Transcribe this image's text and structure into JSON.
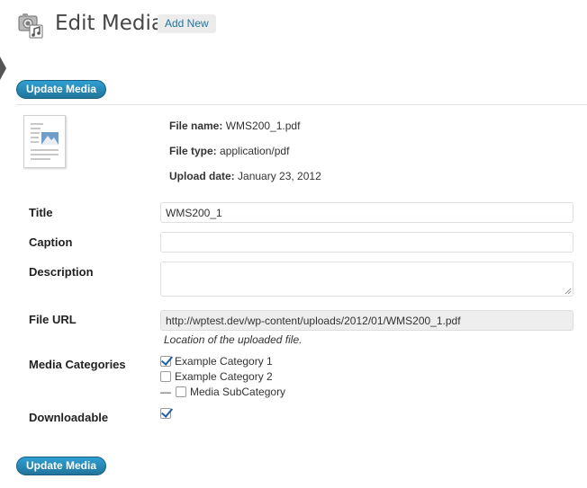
{
  "header": {
    "icon": "media-library-icon",
    "title": "Edit Media",
    "add_new_label": "Add New"
  },
  "actions": {
    "update_label": "Update Media"
  },
  "file_info": {
    "name_label": "File name:",
    "name_value": "WMS200_1.pdf",
    "type_label": "File type:",
    "type_value": "application/pdf",
    "date_label": "Upload date:",
    "date_value": "January 23, 2012"
  },
  "fields": {
    "title_label": "Title",
    "title_value": "WMS200_1",
    "caption_label": "Caption",
    "caption_value": "",
    "description_label": "Description",
    "description_value": "",
    "url_label": "File URL",
    "url_value": "http://wptest.dev/wp-content/uploads/2012/01/WMS200_1.pdf",
    "url_note": "Location of the uploaded file."
  },
  "categories": {
    "label": "Media Categories",
    "items": [
      {
        "label": "Example Category 1",
        "checked": true
      },
      {
        "label": "Example Category 2",
        "checked": false
      },
      {
        "label": "Media SubCategory",
        "checked": false,
        "prefix": "—"
      }
    ]
  },
  "downloadable": {
    "label": "Downloadable",
    "checked": true
  },
  "colors": {
    "button_blue": "#21759b",
    "link_blue": "#21759b",
    "checkmark_blue": "#1f5ea8"
  }
}
